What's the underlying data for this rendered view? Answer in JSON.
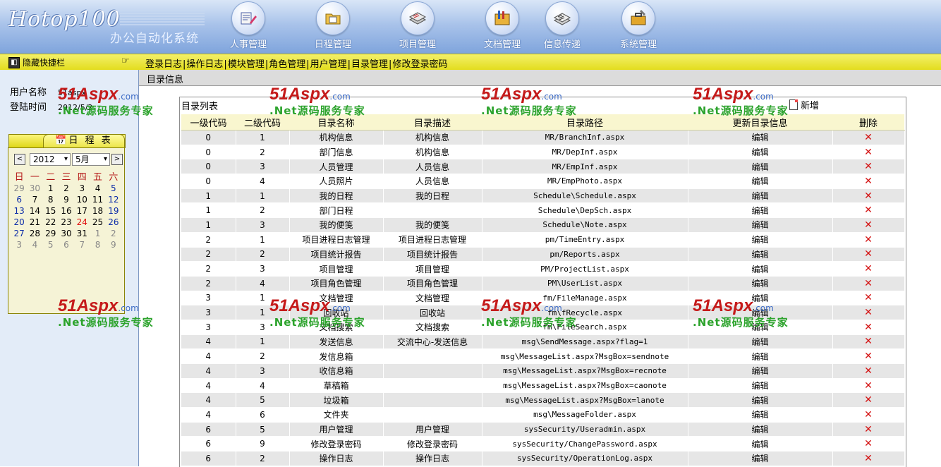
{
  "header": {
    "logo": "Hotop100",
    "subtitle": "办公自动化系统",
    "nav": [
      {
        "label": "人事管理",
        "icon": "personnel-icon"
      },
      {
        "label": "日程管理",
        "icon": "schedule-folder-icon"
      },
      {
        "label": "项目管理",
        "icon": "project-stack-icon"
      },
      {
        "label": "文档管理",
        "icon": "document-tools-icon"
      },
      {
        "label": "信息传递",
        "icon": "message-stack-icon"
      },
      {
        "label": "系统管理",
        "icon": "system-toolbox-icon"
      }
    ]
  },
  "toolbar": {
    "hide_label": "隐藏快捷栏",
    "links": [
      "登录日志",
      "操作日志",
      "模块管理",
      "角色管理",
      "用户管理",
      "目录管理",
      "修改登录密码"
    ]
  },
  "user": {
    "name_label": "用户名称",
    "name_value": "51aspx",
    "time_label": "登陆时间",
    "time_value": "2012/5/2"
  },
  "calendar": {
    "title": "日 程 表",
    "prev": "<",
    "next": ">",
    "year": "2012",
    "month": "5月",
    "weekdays": [
      "日",
      "一",
      "二",
      "三",
      "四",
      "五",
      "六"
    ],
    "weeks": [
      [
        "29",
        "30",
        "1",
        "2",
        "3",
        "4",
        "5"
      ],
      [
        "6",
        "7",
        "8",
        "9",
        "10",
        "11",
        "12"
      ],
      [
        "13",
        "14",
        "15",
        "16",
        "17",
        "18",
        "19"
      ],
      [
        "20",
        "21",
        "22",
        "23",
        "24",
        "25",
        "26"
      ],
      [
        "27",
        "28",
        "29",
        "30",
        "31",
        "1",
        "2"
      ],
      [
        "3",
        "4",
        "5",
        "6",
        "7",
        "8",
        "9"
      ]
    ]
  },
  "main": {
    "title": "目录信息",
    "list_title": "目录列表",
    "add_label": "新增",
    "columns": [
      "一级代码",
      "二级代码",
      "目录名称",
      "目录描述",
      "目录路径",
      "更新目录信息",
      "删除"
    ],
    "edit_label": "编辑",
    "delete_glyph": "✕",
    "rows": [
      [
        "0",
        "1",
        "机构信息",
        "机构信息",
        "MR/BranchInf.aspx"
      ],
      [
        "0",
        "2",
        "部门信息",
        "机构信息",
        "MR/DepInf.aspx"
      ],
      [
        "0",
        "3",
        "人员管理",
        "人员信息",
        "MR/EmpInf.aspx"
      ],
      [
        "0",
        "4",
        "人员照片",
        "人员信息",
        "MR/EmpPhoto.aspx"
      ],
      [
        "1",
        "1",
        "我的日程",
        "我的日程",
        "Schedule\\Schedule.aspx"
      ],
      [
        "1",
        "2",
        "部门日程",
        "",
        "Schedule\\DepSch.aspx"
      ],
      [
        "1",
        "3",
        "我的便笺",
        "我的便笺",
        "Schedule\\Note.aspx"
      ],
      [
        "2",
        "1",
        "项目进程日志管理",
        "项目进程日志管理",
        "pm/TimeEntry.aspx"
      ],
      [
        "2",
        "2",
        "项目统计报告",
        "项目统计报告",
        "pm/Reports.aspx"
      ],
      [
        "2",
        "3",
        "项目管理",
        "项目管理",
        "PM/ProjectList.aspx"
      ],
      [
        "2",
        "4",
        "项目角色管理",
        "项目角色管理",
        "PM\\UserList.aspx"
      ],
      [
        "3",
        "1",
        "文档管理",
        "文档管理",
        "fm/FileManage.aspx"
      ],
      [
        "3",
        "1",
        "回收站",
        "回收站",
        "fm\\fRecycle.aspx"
      ],
      [
        "3",
        "3",
        "文档搜索",
        "文档搜索",
        "fm\\FileSearch.aspx"
      ],
      [
        "4",
        "1",
        "发送信息",
        "交流中心-发送信息",
        "msg\\SendMessage.aspx?flag=1"
      ],
      [
        "4",
        "2",
        "发信息箱",
        "",
        "msg\\MessageList.aspx?MsgBox=sendnote"
      ],
      [
        "4",
        "3",
        "收信息箱",
        "",
        "msg\\MessageList.aspx?MsgBox=recnote"
      ],
      [
        "4",
        "4",
        "草稿箱",
        "",
        "msg\\MessageList.aspx?MsgBox=caonote"
      ],
      [
        "4",
        "5",
        "垃圾箱",
        "",
        "msg\\MessageList.aspx?MsgBox=lanote"
      ],
      [
        "4",
        "6",
        "文件夹",
        "",
        "msg\\MessageFolder.aspx"
      ],
      [
        "6",
        "5",
        "用户管理",
        "用户管理",
        "sysSecurity/Useradmin.aspx"
      ],
      [
        "6",
        "9",
        "修改登录密码",
        "修改登录密码",
        "sysSecurity/ChangePassword.aspx"
      ],
      [
        "6",
        "2",
        "操作日志",
        "操作日志",
        "sysSecurity/OperationLog.aspx"
      ]
    ]
  },
  "watermark": {
    "brand_a": "51Aspx",
    "brand_b": ".com",
    "tagline": ".Net源码服务专家"
  },
  "colors": {
    "accent_yellow": "#e3dd1e",
    "header_blue": "#7fa4dc",
    "delete_red": "#d41212"
  }
}
